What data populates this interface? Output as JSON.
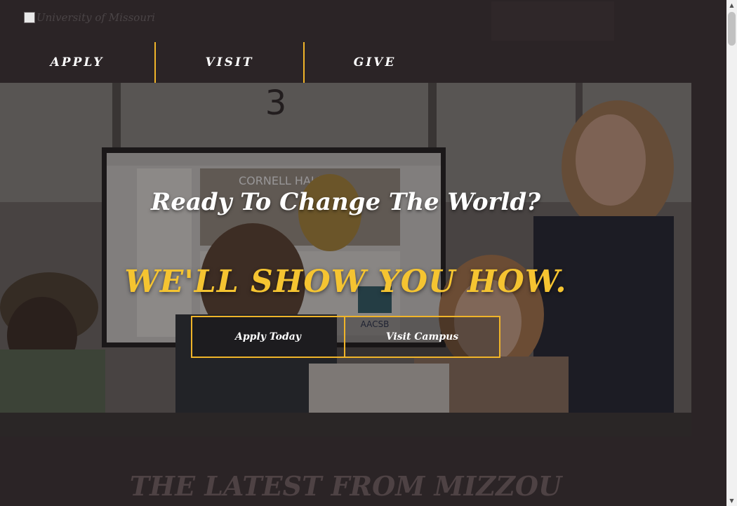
{
  "header": {
    "logo_alt": "University of Missouri",
    "nav": [
      {
        "label": "APPLY"
      },
      {
        "label": "VISIT"
      },
      {
        "label": "GIVE"
      }
    ]
  },
  "hero": {
    "title": "Ready To Change The World?",
    "subtitle": "WE'LL SHOW YOU HOW.",
    "buttons": {
      "apply": "Apply Today",
      "visit": "Visit Campus"
    },
    "screen_text": {
      "building": "CORNELL HALL",
      "aacsb": "AACSB",
      "room": "3"
    }
  },
  "section": {
    "title": "THE LATEST FROM MIZZOU"
  },
  "colors": {
    "accent": "#f0b429",
    "dark": "#2b2426",
    "gold_text": "#f5c431"
  },
  "icons": {
    "scroll_up": "scroll-up-arrow",
    "scroll_down": "scroll-down-arrow"
  }
}
